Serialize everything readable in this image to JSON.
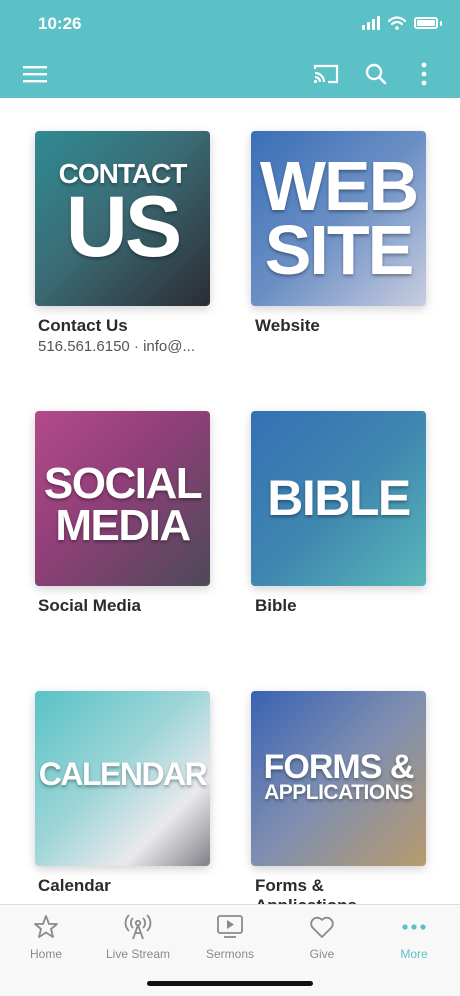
{
  "status_bar": {
    "time": "10:26"
  },
  "toolbar": {
    "menu_icon": "hamburger-menu-icon",
    "cast_icon": "cast-icon",
    "search_icon": "search-icon",
    "more_icon": "kebab-more-icon"
  },
  "items": [
    {
      "tile_lines": [
        "CONTACT",
        "US"
      ],
      "title": "Contact Us",
      "subtitle": "516.561.6150 · info@..."
    },
    {
      "tile_lines": [
        "WEB",
        "SITE"
      ],
      "title": "Website"
    },
    {
      "tile_lines": [
        "SOCIAL",
        "MEDIA"
      ],
      "title": "Social Media"
    },
    {
      "tile_lines": [
        "BIBLE"
      ],
      "title": "Bible"
    },
    {
      "tile_lines": [
        "CALENDAR"
      ],
      "title": "Calendar"
    },
    {
      "tile_lines": [
        "FORMS &",
        "APPLICATIONS"
      ],
      "title_line1": "Forms &",
      "title_line2": "Applications"
    }
  ],
  "tabs": [
    {
      "label": "Home",
      "icon": "star-icon"
    },
    {
      "label": "Live Stream",
      "icon": "broadcast-icon"
    },
    {
      "label": "Sermons",
      "icon": "play-screen-icon"
    },
    {
      "label": "Give",
      "icon": "heart-icon"
    },
    {
      "label": "More",
      "icon": "more-dots-icon",
      "active": true
    }
  ],
  "colors": {
    "accent": "#5bc1c6",
    "tab_inactive": "#8a8a8a"
  }
}
